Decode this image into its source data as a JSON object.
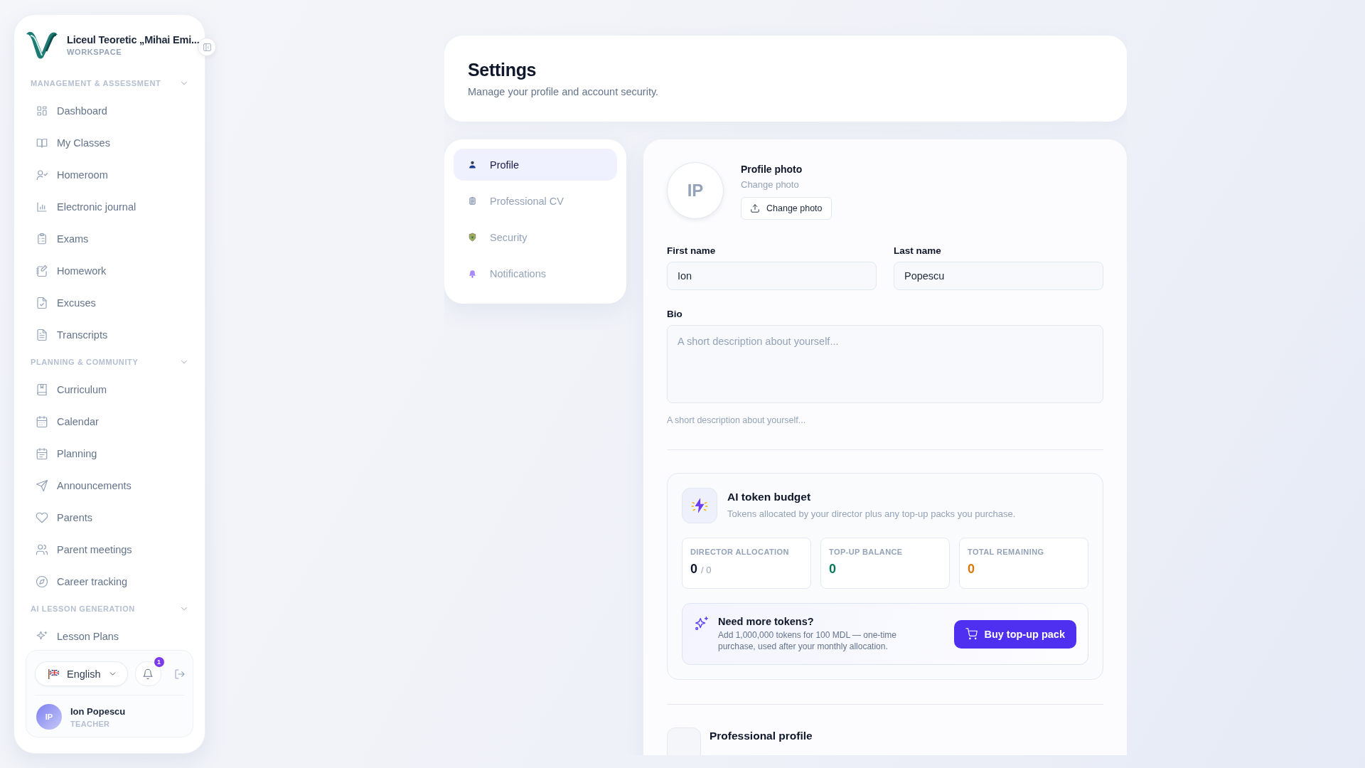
{
  "sidebar": {
    "school": "Liceul Teoretic „Mihai Emi...",
    "workspace": "WORKSPACE",
    "groups": [
      {
        "label": "MANAGEMENT & ASSESSMENT",
        "expanded": true,
        "items": [
          "Dashboard",
          "My Classes",
          "Homeroom",
          "Electronic journal",
          "Exams",
          "Homework",
          "Excuses",
          "Transcripts"
        ]
      },
      {
        "label": "PLANNING & COMMUNITY",
        "expanded": true,
        "items": [
          "Curriculum",
          "Calendar",
          "Planning",
          "Announcements",
          "Parents",
          "Parent meetings",
          "Career tracking"
        ]
      },
      {
        "label": "AI LESSON GENERATION",
        "expanded": true,
        "items": [
          "Lesson Plans"
        ]
      }
    ],
    "language": "English",
    "notifications": "1",
    "user": {
      "initials": "IP",
      "name": "Ion Popescu",
      "role": "TEACHER"
    }
  },
  "header": {
    "title": "Settings",
    "subtitle": "Manage your profile and account security."
  },
  "tabs": [
    {
      "label": "Profile",
      "selected": true
    },
    {
      "label": "Professional CV",
      "selected": false
    },
    {
      "label": "Security",
      "selected": false
    },
    {
      "label": "Notifications",
      "selected": false
    }
  ],
  "profile": {
    "initials": "IP",
    "photo_title": "Profile photo",
    "photo_hint": "Change photo",
    "photo_button": "Change photo",
    "fields": [
      {
        "label": "First name",
        "value": "Ion"
      },
      {
        "label": "Last name",
        "value": "Popescu"
      }
    ],
    "bio": {
      "label": "Bio",
      "placeholder": "A short description about yourself...",
      "helper": "A short description about yourself..."
    }
  },
  "tokens": {
    "title": "AI token budget",
    "description": "Tokens allocated by your director plus any top-up packs you purchase.",
    "stats": [
      {
        "label": "DIRECTOR ALLOCATION",
        "value": "0",
        "total": "/ 0",
        "color": "#0f172a"
      },
      {
        "label": "TOP-UP BALANCE",
        "value": "0",
        "color": "#047857"
      },
      {
        "label": "TOTAL REMAINING",
        "value": "0",
        "color": "#d97706"
      }
    ],
    "promo": {
      "title": "Need more tokens?",
      "text": "Add 1,000,000 tokens for 100 MDL — one-time purchase, used after your monthly allocation.",
      "button": "Buy top-up pack"
    }
  },
  "next_section": {
    "title": "Professional profile"
  }
}
